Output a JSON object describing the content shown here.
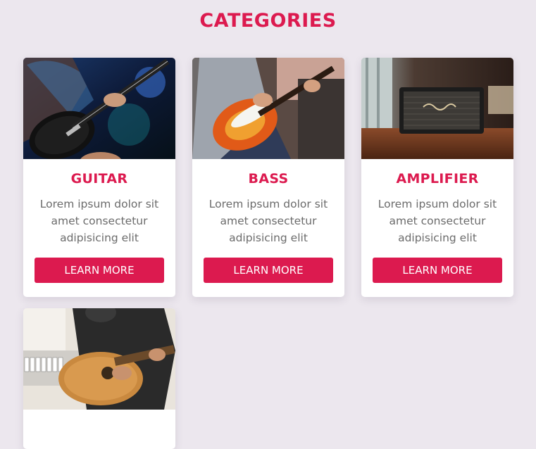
{
  "page": {
    "title": "CATEGORIES"
  },
  "cards": [
    {
      "title": "GUITAR",
      "desc": "Lorem ipsum dolor sit amet consectetur adipisicing elit",
      "button": "LEARN MORE",
      "image": "electric-guitar-photo"
    },
    {
      "title": "BASS",
      "desc": "Lorem ipsum dolor sit amet consectetur adipisicing elit",
      "button": "LEARN MORE",
      "image": "bass-guitar-photo"
    },
    {
      "title": "AMPLIFIER",
      "desc": "Lorem ipsum dolor sit amet consectetur adipisicing elit",
      "button": "LEARN MORE",
      "image": "amplifier-photo"
    },
    {
      "image": "acoustic-guitar-photo"
    }
  ],
  "colors": {
    "accent": "#dc1a4f",
    "background": "#ece7ee",
    "card": "#ffffff",
    "text": "#6b6b6b"
  }
}
